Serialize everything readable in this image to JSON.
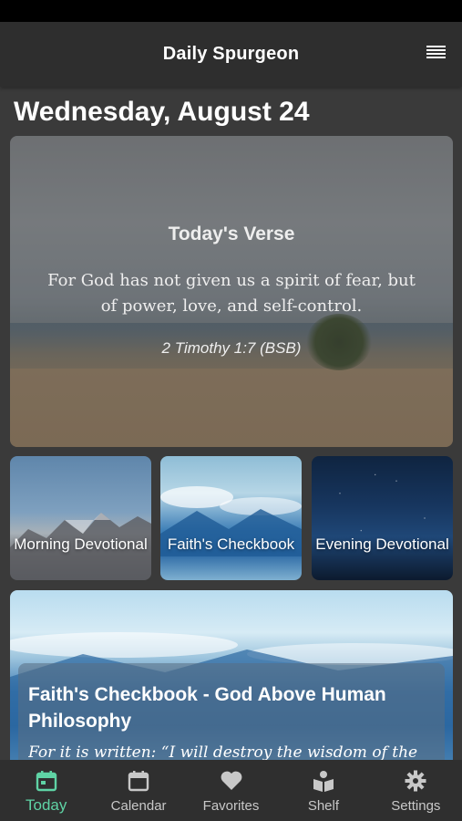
{
  "header": {
    "title": "Daily Spurgeon",
    "menu_icon": "hamburger-menu-icon"
  },
  "date_heading": "Wednesday, August 24",
  "verse": {
    "title": "Today's Verse",
    "text": "For God has not given us a spirit of fear, but of power, love, and self-control.",
    "reference": "2 Timothy 1:7 (BSB)"
  },
  "tiles": [
    {
      "label": "Morning Devotional"
    },
    {
      "label": "Faith's Checkbook"
    },
    {
      "label": "Evening Devotional"
    }
  ],
  "article": {
    "title": "Faith's Checkbook - God Above Human Philosophy",
    "excerpt": "For it is written: “I will destroy the wisdom of the"
  },
  "tabs": [
    {
      "label": "Today",
      "icon": "calendar-today-icon",
      "active": true
    },
    {
      "label": "Calendar",
      "icon": "calendar-icon",
      "active": false
    },
    {
      "label": "Favorites",
      "icon": "heart-icon",
      "active": false
    },
    {
      "label": "Shelf",
      "icon": "book-reader-icon",
      "active": false
    },
    {
      "label": "Settings",
      "icon": "gear-icon",
      "active": false
    }
  ],
  "colors": {
    "accent": "#5fd3a5",
    "background": "#3a3a3a",
    "bar": "#2f2f2f"
  }
}
